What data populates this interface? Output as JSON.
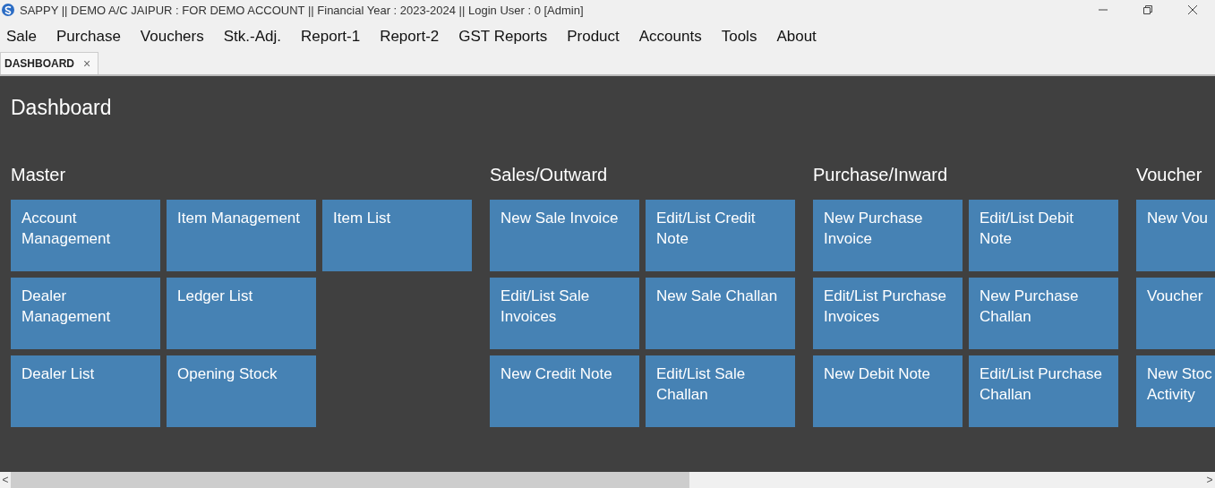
{
  "window": {
    "title": "SAPPY || DEMO A/C JAIPUR : FOR DEMO ACCOUNT || Financial Year : 2023-2024 || Login User : 0 [Admin]"
  },
  "menu": [
    "Sale",
    "Purchase",
    "Vouchers",
    "Stk.-Adj.",
    "Report-1",
    "Report-2",
    "GST Reports",
    "Product",
    "Accounts",
    "Tools",
    "About"
  ],
  "tabs": [
    {
      "label": "DASHBOARD",
      "selected": true,
      "close": "×"
    }
  ],
  "dashboard": {
    "title": "Dashboard",
    "sections": [
      {
        "title": "Master",
        "rows": [
          [
            "Account Management",
            "Item Management",
            "Item List"
          ],
          [
            "Dealer Management",
            "Ledger List"
          ],
          [
            "Dealer List",
            "Opening Stock"
          ]
        ]
      },
      {
        "title": "Sales/Outward",
        "rows": [
          [
            "New Sale Invoice",
            "Edit/List Credit Note"
          ],
          [
            "Edit/List Sale Invoices",
            "New Sale Challan"
          ],
          [
            "New Credit Note",
            "Edit/List Sale Challan"
          ]
        ]
      },
      {
        "title": "Purchase/Inward",
        "rows": [
          [
            "New Purchase Invoice",
            "Edit/List Debit Note"
          ],
          [
            "Edit/List Purchase Invoices",
            "New Purchase Challan"
          ],
          [
            "New Debit Note",
            "Edit/List Purchase Challan"
          ]
        ]
      },
      {
        "title": "Voucher",
        "rows": [
          [
            "New Vou"
          ],
          [
            "Voucher"
          ],
          [
            "New Stoc\nActivity"
          ]
        ]
      }
    ]
  },
  "scrollbar": {
    "left": "<",
    "right": ">"
  }
}
